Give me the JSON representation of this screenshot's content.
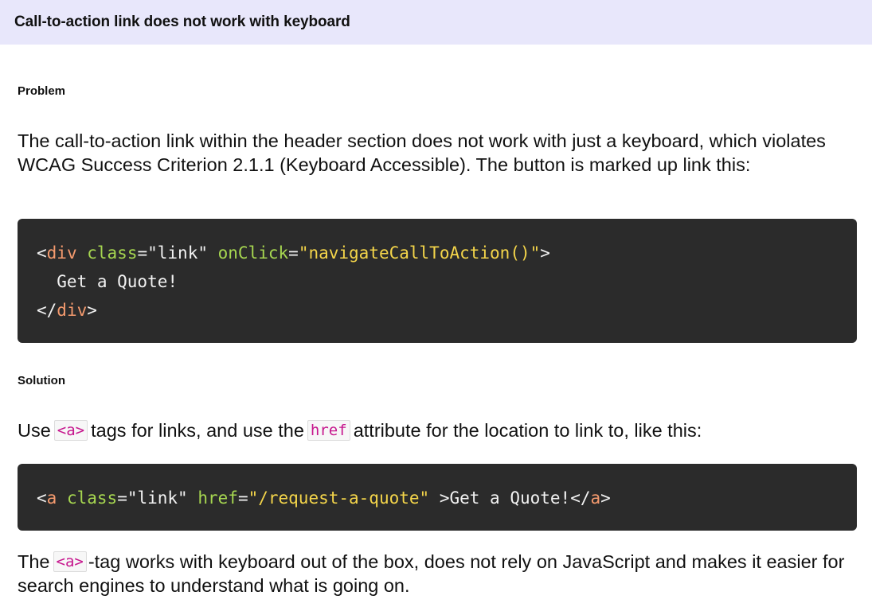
{
  "header": {
    "title": "Call-to-action link does not work with keyboard"
  },
  "problem": {
    "heading": "Problem",
    "text": "The call-to-action link within the header section does not work with just a keyboard, which violates WCAG Success Criterion 2.1.1 (Keyboard Accessible). The button is marked up link this:",
    "code": {
      "line1": {
        "open_lt": "<",
        "tag": "div",
        "attr1_name": "class",
        "eq1": "=",
        "attr1_value": "\"link\"",
        "attr2_name": "onClick",
        "eq2": "=",
        "attr2_value": "\"navigateCallToAction()\"",
        "gt": ">"
      },
      "line2": {
        "text": "  Get a Quote!"
      },
      "line3": {
        "open_lt": "</",
        "tag": "div",
        "gt": ">"
      }
    }
  },
  "solution": {
    "heading": "Solution",
    "text_before_a": "Use",
    "inline_a": "<a>",
    "text_middle": "tags for links, and use the",
    "inline_href": "href",
    "text_after_href": "attribute for the location to link to, like this:",
    "code": {
      "open_lt": "<",
      "tag": "a",
      "attr1_name": "class",
      "eq1": "=",
      "attr1_value": "\"link\"",
      "attr2_name": "href",
      "eq2": "=",
      "attr2_value": "\"/request-a-quote\"",
      "gt_text": " >Get a Quote!",
      "close_lt": "</",
      "close_tag": "a",
      "close_gt": ">"
    },
    "closing_before": "The",
    "closing_inline_a": "<a>",
    "closing_after": "-tag works with keyboard out of the box, does not rely on JavaScript and makes it easier for search engines to understand what is going on."
  },
  "colors": {
    "header_bg": "#e8e7fb",
    "code_bg": "#2b2b2b",
    "tag_name": "#f49a6e",
    "attr_name": "#a6d650",
    "attr_value": "#f4d54a",
    "inline_code": "#c6168d"
  }
}
